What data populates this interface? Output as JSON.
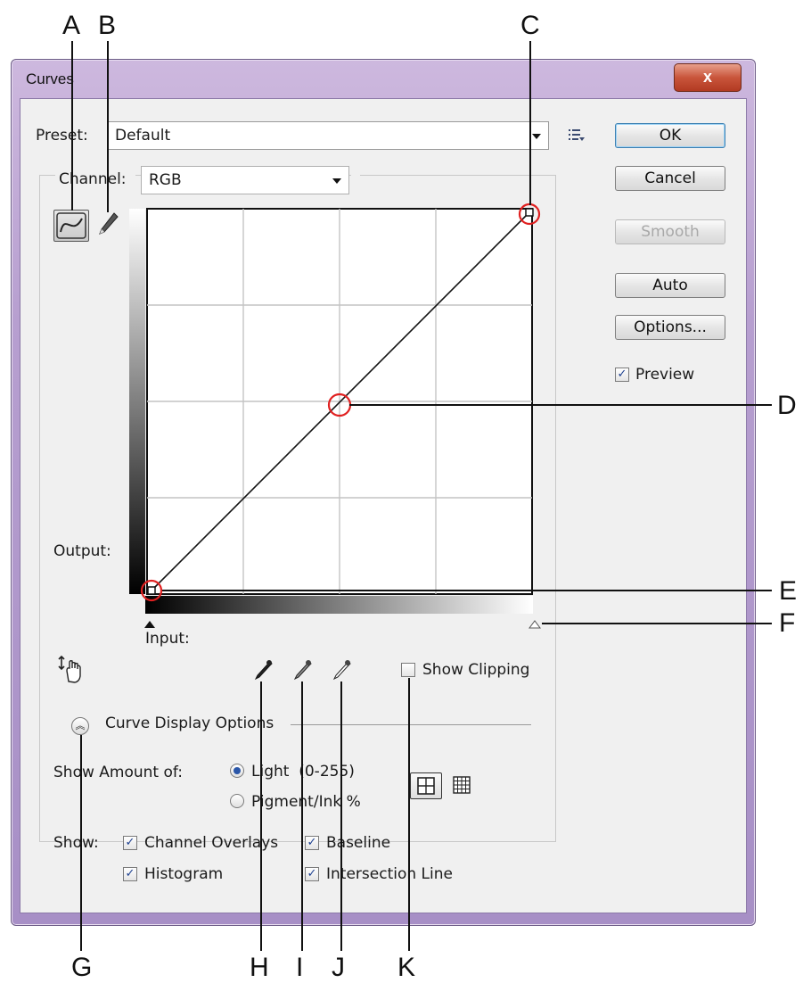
{
  "callouts": {
    "a": "A",
    "b": "B",
    "c": "C",
    "d": "D",
    "e": "E",
    "f": "F",
    "g": "G",
    "h": "H",
    "i": "I",
    "j": "J",
    "k": "K"
  },
  "window": {
    "title": "Curves",
    "close_glyph": "x"
  },
  "preset": {
    "label": "Preset:",
    "value": "Default",
    "menu_icon": "preset-options-icon"
  },
  "channel": {
    "label": "Channel:",
    "value": "RGB"
  },
  "buttons": {
    "ok": "OK",
    "cancel": "Cancel",
    "smooth": "Smooth",
    "auto": "Auto",
    "options": "Options..."
  },
  "preview": {
    "label": "Preview",
    "checked": true
  },
  "graph": {
    "output_label": "Output:",
    "input_label": "Input:",
    "grid_divisions": 4,
    "curve_points": [
      [
        0,
        0
      ],
      [
        128,
        128
      ],
      [
        255,
        255
      ]
    ]
  },
  "tools": {
    "curve_tool_icon": "curve-point-tool-icon",
    "pencil_tool_icon": "pencil-tool-icon",
    "target_adjust_icon": "on-image-adjustment-icon",
    "eyedroppers": [
      "black-point-eyedropper-icon",
      "gray-point-eyedropper-icon",
      "white-point-eyedropper-icon"
    ]
  },
  "show_clipping": {
    "label": "Show Clipping",
    "checked": false
  },
  "display_options": {
    "title": "Curve Display Options",
    "show_amount_label": "Show Amount of:",
    "light_label": "Light  (0-255)",
    "pigment_label": "Pigment/Ink %",
    "selected": "light",
    "show_label": "Show:",
    "channel_overlays": {
      "label": "Channel Overlays",
      "checked": true
    },
    "baseline": {
      "label": "Baseline",
      "checked": true
    },
    "histogram": {
      "label": "Histogram",
      "checked": true
    },
    "intersection_line": {
      "label": "Intersection Line",
      "checked": true
    }
  },
  "colors": {
    "highlight_circle": "#e02020",
    "window_frame": "#b79fd0",
    "ok_border": "#3c7fb1"
  }
}
